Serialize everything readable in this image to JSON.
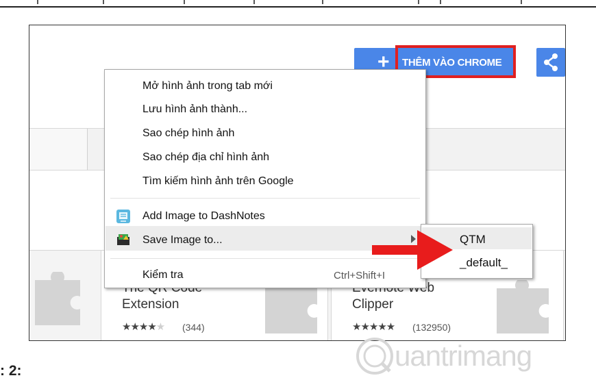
{
  "step_label": ": 2:",
  "store": {
    "add_button_label": "THÊM VÀO CHROME",
    "add_icon": "plus-icon",
    "share_icon": "share-icon"
  },
  "cards": [
    {
      "title_line1": "The QR Code",
      "title_line2": "Extension",
      "stars": "★★★★★",
      "rating_count": "(344)"
    },
    {
      "title_line1": "Evernote Web",
      "title_line2": "Clipper",
      "stars": "★★★★★",
      "rating_count": "(132950)"
    }
  ],
  "context_menu": {
    "items": [
      {
        "label": "Mở hình ảnh trong tab mới"
      },
      {
        "label": "Lưu hình ảnh thành..."
      },
      {
        "label": "Sao chép hình ảnh"
      },
      {
        "label": "Sao chép địa chỉ hình ảnh"
      },
      {
        "label": "Tìm kiếm hình ảnh trên Google"
      },
      {
        "label": "Add Image to DashNotes",
        "icon": "dashnotes-icon"
      },
      {
        "label": "Save Image to...",
        "icon": "save-image-icon"
      },
      {
        "label": "Kiểm tra",
        "shortcut": "Ctrl+Shift+I"
      }
    ]
  },
  "submenu": {
    "items": [
      {
        "label": "QTM"
      },
      {
        "label": "_default_"
      }
    ]
  },
  "watermark": {
    "text": "uantrimang",
    "icon": "quantrimang-logo-icon"
  },
  "colors": {
    "accent_blue": "#4a86e8",
    "highlight_red": "#e02020"
  }
}
